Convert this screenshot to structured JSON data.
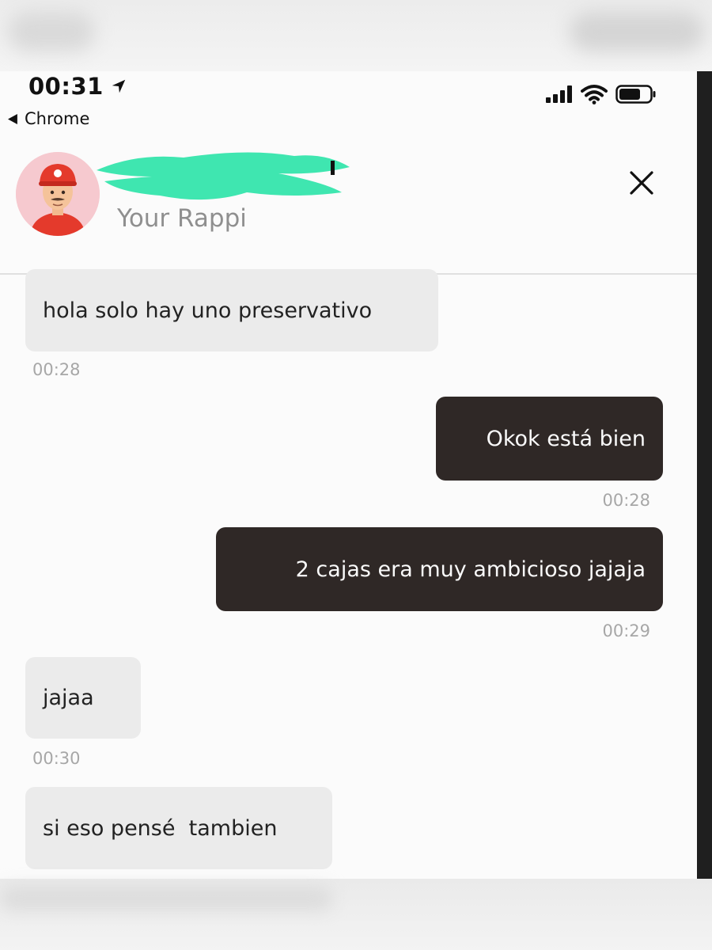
{
  "status_bar": {
    "time": "00:31",
    "back_label": "Chrome",
    "location_icon": "location-arrow-icon",
    "signal_icon": "signal-icon",
    "wifi_icon": "wifi-icon",
    "battery_icon": "battery-icon"
  },
  "chat_header": {
    "subtitle": "Your Rappi",
    "avatar_icon": "courier-avatar-icon",
    "close_icon": "close-icon"
  },
  "messages": [
    {
      "direction": "incoming",
      "text": "hola solo hay uno preservativo",
      "time": "00:28"
    },
    {
      "direction": "outgoing",
      "text": "Okok está bien",
      "time": "00:28"
    },
    {
      "direction": "outgoing",
      "text": "2 cajas era muy ambicioso jajaja",
      "time": "00:29"
    },
    {
      "direction": "incoming",
      "text": "jajaa",
      "time": "00:30"
    },
    {
      "direction": "incoming",
      "text": "si eso pensé  tambien",
      "time": ""
    }
  ],
  "colors": {
    "incoming_bubble": "#ebebeb",
    "outgoing_bubble": "#2f2826",
    "scribble": "#3fe6b0",
    "timestamp": "#a7a7a7"
  }
}
